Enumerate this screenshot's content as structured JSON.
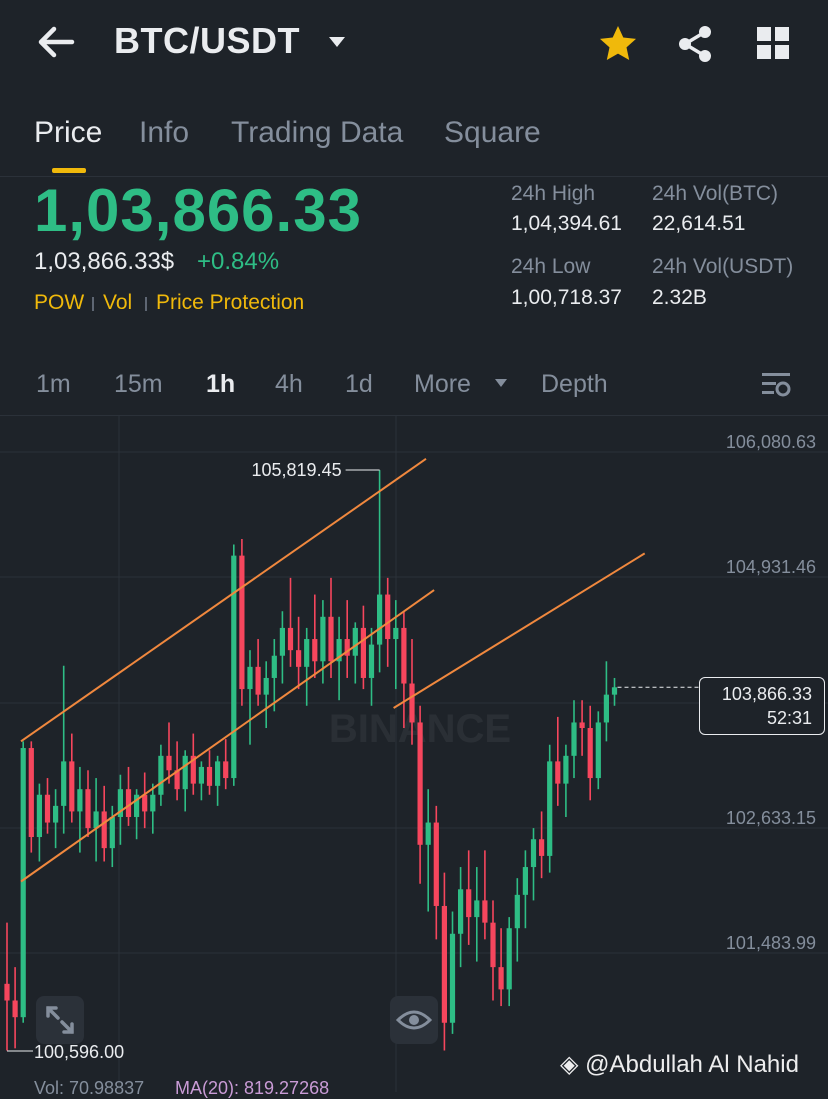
{
  "header": {
    "pair": "BTC/USDT",
    "icons": [
      "back-arrow-icon",
      "caret-down-icon",
      "star-icon",
      "share-icon",
      "grid-icon"
    ],
    "star_color": "#f0b90b"
  },
  "tabs": [
    {
      "label": "Price",
      "active": true
    },
    {
      "label": "Info",
      "active": false
    },
    {
      "label": "Trading Data",
      "active": false
    },
    {
      "label": "Square",
      "active": false
    }
  ],
  "ticker": {
    "last_price": "1,03,866.33",
    "last_price_usd": "1,03,866.33$",
    "change_pct": "+0.84%",
    "tags": [
      "POW",
      "Vol",
      "Price Protection"
    ],
    "stats": [
      {
        "label": "24h High",
        "value": "1,04,394.61"
      },
      {
        "label": "24h Vol(BTC)",
        "value": "22,614.51"
      },
      {
        "label": "24h Low",
        "value": "1,00,718.37"
      },
      {
        "label": "24h Vol(USDT)",
        "value": "2.32B"
      }
    ],
    "up_color": "#2ebd85",
    "down_color": "#f6465d",
    "accent_color": "#f0b90b"
  },
  "intervals": [
    {
      "label": "1m",
      "active": false
    },
    {
      "label": "15m",
      "active": false
    },
    {
      "label": "1h",
      "active": true
    },
    {
      "label": "4h",
      "active": false
    },
    {
      "label": "1d",
      "active": false
    },
    {
      "label": "More",
      "active": false
    },
    {
      "label": "Depth",
      "active": false
    }
  ],
  "chart_data": {
    "type": "candlestick",
    "y_axis_labels": [
      "106,080.63",
      "104,931.46",
      "102,633.15",
      "101,483.99"
    ],
    "ylim": [
      100450,
      106300
    ],
    "annotations": {
      "high_label": "105,819.45",
      "high_value": 105819.45,
      "low_label": "100,596.00",
      "low_value": 100596.0
    },
    "current": {
      "price_label": "103,866.33",
      "value": 103866.33,
      "countdown": "52:31"
    },
    "watermark": "BINANCE",
    "trendlines_color": "#f0883e",
    "trendlines": [
      {
        "from": [
          0,
          103380
        ],
        "to": [
          50,
          105920
        ]
      },
      {
        "from": [
          0,
          102120
        ],
        "to": [
          51,
          104740
        ]
      },
      {
        "from": [
          46,
          103680
        ],
        "to": [
          77,
          105070
        ]
      }
    ],
    "candles": [
      [
        101200,
        101750,
        100600,
        101050
      ],
      [
        101050,
        101350,
        100620,
        100900
      ],
      [
        100900,
        103380,
        100850,
        103320
      ],
      [
        103320,
        103380,
        102380,
        102520
      ],
      [
        102520,
        103000,
        102300,
        102900
      ],
      [
        102900,
        103050,
        102550,
        102650
      ],
      [
        102650,
        102950,
        102420,
        102800
      ],
      [
        102800,
        104060,
        102550,
        103200
      ],
      [
        103200,
        103450,
        102650,
        102750
      ],
      [
        102750,
        103150,
        102380,
        102950
      ],
      [
        102950,
        103120,
        102520,
        102600
      ],
      [
        102600,
        103050,
        102300,
        102750
      ],
      [
        102750,
        102980,
        102300,
        102420
      ],
      [
        102420,
        102800,
        102250,
        102700
      ],
      [
        102700,
        103080,
        102450,
        102950
      ],
      [
        102950,
        103150,
        102620,
        102700
      ],
      [
        102700,
        102950,
        102500,
        102900
      ],
      [
        102900,
        103100,
        102600,
        102750
      ],
      [
        102750,
        103000,
        102550,
        102900
      ],
      [
        102900,
        103350,
        102800,
        103250
      ],
      [
        103250,
        103550,
        103000,
        103120
      ],
      [
        103120,
        103380,
        102850,
        102950
      ],
      [
        102950,
        103300,
        102750,
        103250
      ],
      [
        103250,
        103450,
        102900,
        103000
      ],
      [
        103000,
        103200,
        102850,
        103150
      ],
      [
        103150,
        103300,
        102900,
        102980
      ],
      [
        102980,
        103250,
        102800,
        103200
      ],
      [
        103200,
        103400,
        102950,
        103050
      ],
      [
        103050,
        105150,
        102980,
        105050
      ],
      [
        105050,
        105200,
        103700,
        103850
      ],
      [
        103850,
        104200,
        103350,
        104050
      ],
      [
        104050,
        104300,
        103700,
        103800
      ],
      [
        103800,
        104100,
        103500,
        103950
      ],
      [
        103950,
        104300,
        103650,
        104150
      ],
      [
        104150,
        104550,
        103900,
        104400
      ],
      [
        104400,
        104850,
        104050,
        104200
      ],
      [
        104200,
        104500,
        103850,
        104050
      ],
      [
        104050,
        104400,
        103700,
        104300
      ],
      [
        104300,
        104700,
        103950,
        104100
      ],
      [
        104100,
        104650,
        103900,
        104500
      ],
      [
        104500,
        104850,
        103950,
        104100
      ],
      [
        104100,
        104500,
        103750,
        104300
      ],
      [
        104300,
        104650,
        103950,
        104150
      ],
      [
        104150,
        104450,
        103900,
        104400
      ],
      [
        104400,
        104600,
        103850,
        103950
      ],
      [
        103950,
        104400,
        103700,
        104250
      ],
      [
        104250,
        105819,
        104000,
        104700
      ],
      [
        104700,
        104850,
        104050,
        104300
      ],
      [
        104300,
        104650,
        103850,
        104400
      ],
      [
        104400,
        104550,
        103500,
        103900
      ],
      [
        103900,
        104300,
        103350,
        103550
      ],
      [
        103550,
        103700,
        102100,
        102450
      ],
      [
        102450,
        102950,
        101850,
        102650
      ],
      [
        102650,
        102800,
        101600,
        101900
      ],
      [
        101900,
        102200,
        100600,
        100850
      ],
      [
        100850,
        101850,
        100750,
        101650
      ],
      [
        101650,
        102250,
        101350,
        102050
      ],
      [
        102050,
        102400,
        101550,
        101800
      ],
      [
        101800,
        102250,
        101400,
        101950
      ],
      [
        101950,
        102400,
        101600,
        101750
      ],
      [
        101750,
        101950,
        101050,
        101350
      ],
      [
        101350,
        101700,
        101000,
        101150
      ],
      [
        101150,
        101800,
        101000,
        101700
      ],
      [
        101700,
        102150,
        101400,
        102000
      ],
      [
        102000,
        102400,
        101700,
        102250
      ],
      [
        102250,
        102600,
        101950,
        102500
      ],
      [
        102500,
        102750,
        102150,
        102350
      ],
      [
        102350,
        103350,
        102200,
        103200
      ],
      [
        103200,
        103600,
        102800,
        103000
      ],
      [
        103000,
        103350,
        102700,
        103250
      ],
      [
        103250,
        103750,
        103050,
        103550
      ],
      [
        103550,
        103750,
        103250,
        103500
      ],
      [
        103500,
        103700,
        102850,
        103050
      ],
      [
        103050,
        103650,
        102950,
        103550
      ],
      [
        103550,
        104100,
        103380,
        103800
      ],
      [
        103800,
        103950,
        103700,
        103866.33
      ]
    ]
  },
  "bottom": {
    "volume_text": "Vol: 70.98837",
    "ma_text": "MA(20): 819.27268",
    "watermark": "@Abdullah Al Nahid"
  }
}
